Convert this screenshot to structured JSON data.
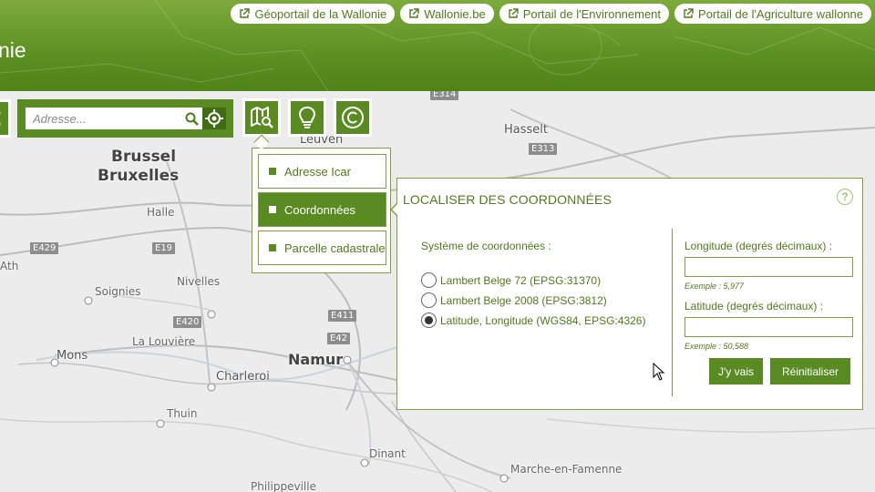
{
  "header": {
    "title": "nie",
    "portal_links": [
      {
        "label": "Géoportail de la Wallonie",
        "icon": "external-link-icon"
      },
      {
        "label": "Wallonie.be",
        "icon": "external-link-icon"
      },
      {
        "label": "Portail de l'Environnement",
        "icon": "external-link-icon"
      },
      {
        "label": "Portail de l'Agriculture wallonne",
        "icon": "external-link-icon"
      }
    ]
  },
  "toolbar": {
    "search": {
      "placeholder": "Adresse..."
    },
    "buttons": [
      {
        "name": "search-icon"
      },
      {
        "name": "geolocate-icon"
      },
      {
        "name": "map-search-icon"
      },
      {
        "name": "lightbulb-icon"
      },
      {
        "name": "copyright-icon"
      }
    ]
  },
  "locate_menu": {
    "items": [
      {
        "label": "Adresse Icar",
        "active": false
      },
      {
        "label": "Coordonnées",
        "active": true
      },
      {
        "label": "Parcelle cadastrale",
        "active": false
      }
    ]
  },
  "panel": {
    "title": "LOCALISER DES COORDONNÉES",
    "help": "?",
    "system_label": "Système de coordonnées :",
    "systems": [
      {
        "label": "Lambert Belge 72 (EPSG:31370)",
        "checked": false
      },
      {
        "label": "Lambert Belge 2008 (EPSG:3812)",
        "checked": false
      },
      {
        "label": "Latitude, Longitude (WGS84, EPSG:4326)",
        "checked": true
      }
    ],
    "longitude_label": "Longitude (degrés décimaux) :",
    "longitude_value": "",
    "longitude_example": "Exemple : 5,977",
    "latitude_label": "Latitude (degrés décimaux) :",
    "latitude_value": "",
    "latitude_example": "Exemple : 50,588",
    "go_button": "J'y vais",
    "reset_button": "Réinitialiser"
  },
  "map": {
    "cities": [
      "Brussel",
      "Bruxelles",
      "Leuven",
      "Hasselt",
      "Halle",
      "Ath",
      "Nivelles",
      "Soignies",
      "La Louvière",
      "Mons",
      "Charleroi",
      "Namur",
      "Thuin",
      "Dinant",
      "Marche-en-Famenne",
      "Philippeville"
    ],
    "roads": [
      "E314",
      "E313",
      "E429",
      "E19",
      "E420",
      "E411",
      "E42"
    ]
  },
  "colors": {
    "brand_green": "#5a8a22",
    "header_green": "#6a9a2e",
    "text_green": "#4f7a1c"
  }
}
